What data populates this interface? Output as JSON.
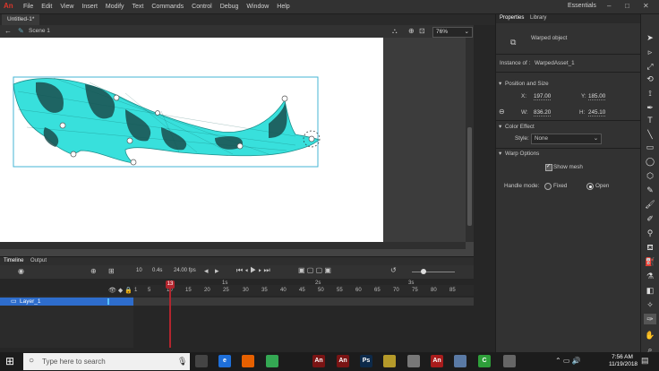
{
  "app": {
    "logo": "An"
  },
  "menu": [
    "File",
    "Edit",
    "View",
    "Insert",
    "Modify",
    "Text",
    "Commands",
    "Control",
    "Debug",
    "Window",
    "Help"
  ],
  "workspace": "Essentials",
  "document": {
    "tab": "Untitled-1*",
    "scene": "Scene 1",
    "zoom": "76%"
  },
  "timeline": {
    "tabs": [
      "Timeline",
      "Output"
    ],
    "fps": "24.00",
    "fps_unit": "fps",
    "frame_number": "10",
    "frame_seconds": "0.4",
    "frame_seconds_unit": "s",
    "current_frame": "13",
    "seconds_marks": [
      "1s",
      "2s",
      "3s"
    ],
    "ruler_labels": [
      "1",
      "5",
      "10",
      "15",
      "20",
      "25",
      "30",
      "35",
      "40",
      "45",
      "50",
      "55",
      "60",
      "65",
      "70",
      "75",
      "80",
      "85"
    ],
    "layer_name": "Layer_1"
  },
  "properties": {
    "tabs": [
      "Properties",
      "Library"
    ],
    "object_type": "Warped object",
    "instance_label": "Instance of :",
    "instance_name": "WarpedAsset_1",
    "position_section": "Position and Size",
    "x_label": "X:",
    "x": "197.00",
    "y_label": "Y:",
    "y": "185.00",
    "w_label": "W:",
    "w": "836.20",
    "h_label": "H:",
    "h": "245.10",
    "color_section": "Color Effect",
    "style_label": "Style:",
    "style_value": "None",
    "warp_section": "Warp Options",
    "show_mesh_label": "Show mesh",
    "show_mesh": true,
    "handle_mode_label": "Handle mode:",
    "handle_fixed_label": "Fixed",
    "handle_open_label": "Open",
    "handle_mode": "Open"
  },
  "taskbar": {
    "search_placeholder": "Type here to search",
    "time": "7:56 AM",
    "date": "11/19/2018",
    "apps": [
      {
        "name": "task-view-icon",
        "label": "",
        "color": "#444444"
      },
      {
        "name": "edge-icon",
        "label": "e",
        "color": "#1e6fd9"
      },
      {
        "name": "firefox-icon",
        "label": "",
        "color": "#e66000"
      },
      {
        "name": "chrome-icon",
        "label": "",
        "color": "#34a853"
      },
      {
        "name": "animate-icon",
        "label": "An",
        "color": "#7a1414"
      },
      {
        "name": "animate-icon-2",
        "label": "An",
        "color": "#7a1414"
      },
      {
        "name": "photoshop-icon",
        "label": "Ps",
        "color": "#0d2a4a"
      },
      {
        "name": "app-icon-yellow",
        "label": "",
        "color": "#b59a2a"
      },
      {
        "name": "app-icon-grey",
        "label": "",
        "color": "#777777"
      },
      {
        "name": "animate-icon-active",
        "label": "An",
        "color": "#a81c1c"
      },
      {
        "name": "app-icon-blue",
        "label": "",
        "color": "#5a7aa5"
      },
      {
        "name": "camtasia-icon",
        "label": "C",
        "color": "#2e9f3a"
      },
      {
        "name": "media-icon",
        "label": "",
        "color": "#666666"
      }
    ]
  },
  "colors": {
    "accent": "#2e6dcc",
    "playhead": "#b3252e",
    "mesh": "#38e0dc",
    "mesh_dark": "#1a4d4d",
    "selection": "#45b6d6"
  }
}
